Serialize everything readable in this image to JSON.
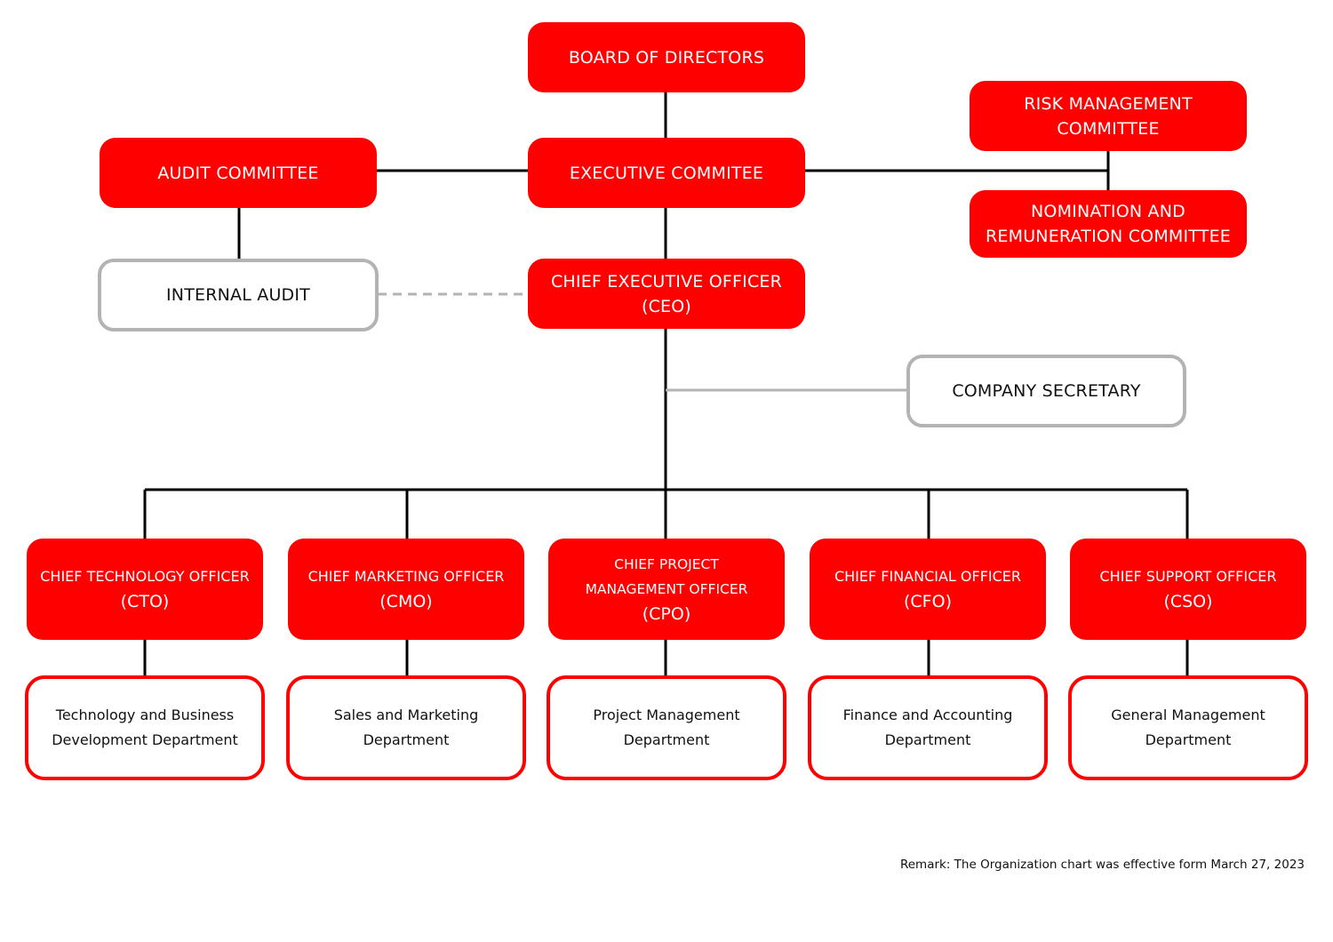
{
  "colors": {
    "primary": "#ff0000",
    "neutral_border": "#b3b3b3",
    "connector": "#000000",
    "dashed": "#b3b3b3"
  },
  "governance": {
    "board": "BOARD OF DIRECTORS",
    "executive_committee": "EXECUTIVE COMMITEE",
    "audit_committee": "AUDIT COMMITTEE",
    "risk_committee": [
      "RISK MANAGEMENT",
      "COMMITTEE"
    ],
    "nomination_committee": [
      "NOMINATION AND",
      "REMUNERATION COMMITTEE"
    ],
    "internal_audit": "INTERNAL AUDIT",
    "ceo": [
      "CHIEF EXECUTIVE OFFICER",
      "(CEO)"
    ],
    "company_secretary": "COMPANY SECRETARY"
  },
  "officers": [
    {
      "title": [
        "CHIEF TECHNOLOGY OFFICER",
        "(CTO)"
      ],
      "department": [
        "Technology and Business",
        "Development Department"
      ]
    },
    {
      "title": [
        "CHIEF MARKETING OFFICER",
        "(CMO)"
      ],
      "department": [
        "Sales and Marketing",
        "Department"
      ]
    },
    {
      "title": [
        "CHIEF PROJECT",
        "MANAGEMENT OFFICER",
        "(CPO)"
      ],
      "department": [
        "Project Management",
        "Department"
      ]
    },
    {
      "title": [
        "CHIEF FINANCIAL OFFICER",
        "(CFO)"
      ],
      "department": [
        "Finance and Accounting",
        "Department"
      ]
    },
    {
      "title": [
        "CHIEF SUPPORT OFFICER",
        "(CSO)"
      ],
      "department": [
        "General Management",
        "Department"
      ]
    }
  ],
  "remark": "Remark: The Organization chart was effective form March 27, 2023"
}
